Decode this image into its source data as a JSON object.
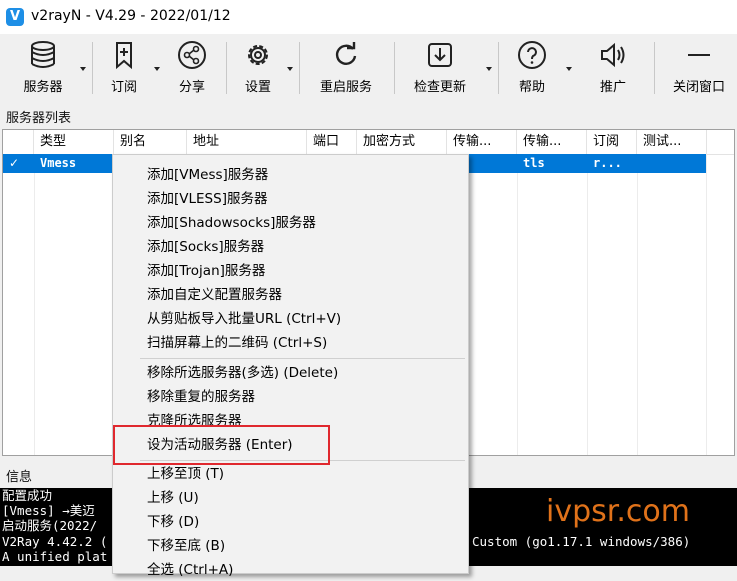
{
  "window": {
    "title": "v2rayN - V4.29 - 2022/01/12",
    "app_icon": "V"
  },
  "toolbar": {
    "servers": "服务器",
    "subscription": "订阅",
    "share": "分享",
    "settings": "设置",
    "restart_service": "重启服务",
    "check_update": "检查更新",
    "help": "帮助",
    "promotion": "推广",
    "close_window": "关闭窗口"
  },
  "server_list": {
    "label": "服务器列表",
    "columns": [
      "",
      "类型",
      "别名",
      "地址",
      "端口",
      "加密方式",
      "传输...",
      "传输...",
      "订阅",
      "测试..."
    ],
    "rows": [
      {
        "active": "✓",
        "type": "Vmess",
        "alias": "",
        "address": "",
        "port": "",
        "security": "",
        "network": "",
        "tls": "tls",
        "sub": "r..."
      }
    ]
  },
  "info": {
    "label": "信息",
    "log_lines": [
      "配置成功",
      "[Vmess] →美迈",
      "启动服务(2022/",
      "V2Ray 4.42.2 (",
      "A unified plat"
    ],
    "log_right": "Custom (go1.17.1 windows/386)"
  },
  "watermark": "ivpsr.com",
  "context_menu": {
    "items": [
      "添加[VMess]服务器",
      "添加[VLESS]服务器",
      "添加[Shadowsocks]服务器",
      "添加[Socks]服务器",
      "添加[Trojan]服务器",
      "添加自定义配置服务器",
      "从剪贴板导入批量URL (Ctrl+V)",
      "扫描屏幕上的二维码 (Ctrl+S)",
      "移除所选服务器(多选) (Delete)",
      "移除重复的服务器",
      "克隆所选服务器",
      "设为活动服务器 (Enter)",
      "上移至顶 (T)",
      "上移 (U)",
      "下移 (D)",
      "下移至底 (B)",
      "全选 (Ctrl+A)"
    ]
  },
  "colors": {
    "selection": "#0078d7",
    "highlight_box": "#e0282e",
    "watermark": "#e0721a",
    "app_icon": "#1e8fe6"
  }
}
